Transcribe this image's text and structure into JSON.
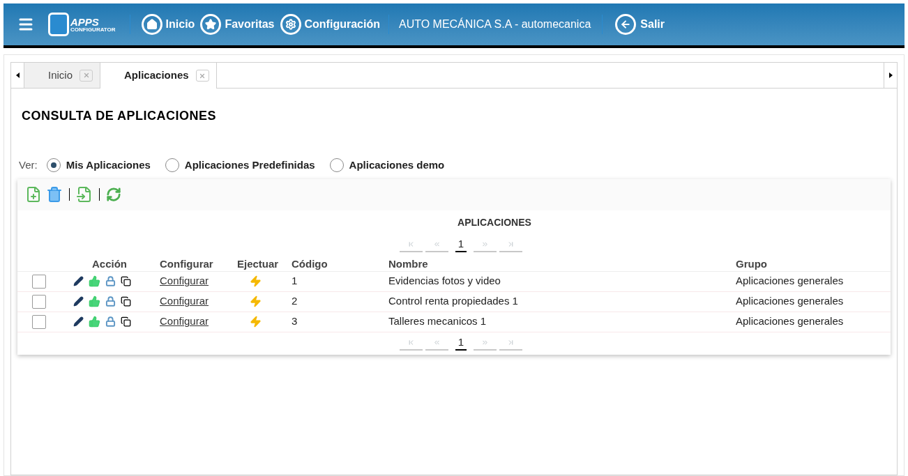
{
  "header": {
    "logo_text": "APPS",
    "logo_subtext": "CONFIGURATOR",
    "nav": [
      {
        "kind": "home",
        "label": "Inicio"
      },
      {
        "kind": "star",
        "label": "Favoritas"
      },
      {
        "kind": "gear",
        "label": "Configuración"
      }
    ],
    "company": "AUTO MECÁNICA S.A - automecanica",
    "logout": {
      "kind": "logout",
      "label": "Salir"
    }
  },
  "tabs": [
    {
      "label": "Inicio",
      "selected": false
    },
    {
      "label": "Aplicaciones",
      "selected": true
    }
  ],
  "title": "CONSULTA DE APLICACIONES",
  "view": {
    "label": "Ver:",
    "options": [
      {
        "label": "Mis Aplicaciones",
        "selected": true
      },
      {
        "label": "Aplicaciones Predefinidas",
        "selected": false
      },
      {
        "label": "Aplicaciones demo",
        "selected": false
      }
    ]
  },
  "grid": {
    "caption": "APLICACIONES",
    "pager_top": {
      "page": "1"
    },
    "pager_bottom": {
      "page": "1"
    },
    "columns": [
      "Acción",
      "Configurar",
      "Ejectuar",
      "Código",
      "Nombre",
      "Grupo"
    ],
    "rows": [
      {
        "checked": false,
        "configure": "Configurar",
        "code": "1",
        "name": "Evidencias fotos y video",
        "group": "Aplicaciones generales"
      },
      {
        "checked": false,
        "configure": "Configurar",
        "code": "2",
        "name": "Control renta propiedades 1",
        "group": "Aplicaciones generales"
      },
      {
        "checked": false,
        "configure": "Configurar",
        "code": "3",
        "name": "Talleres mecanicos 1",
        "group": "Aplicaciones generales"
      }
    ]
  }
}
